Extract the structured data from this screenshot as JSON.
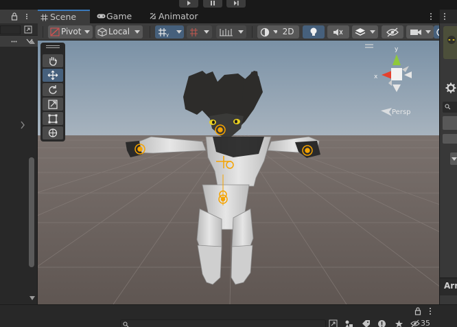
{
  "tabs": [
    {
      "label": "Scene",
      "icon": "grid-icon",
      "active": true
    },
    {
      "label": "Game",
      "icon": "gamepad-icon",
      "active": false
    },
    {
      "label": "Animator",
      "icon": "animator-icon",
      "active": false
    }
  ],
  "toolbar": {
    "pivot_label": "Pivot",
    "local_label": "Local",
    "mode_2d_label": "2D"
  },
  "gizmo": {
    "axis_x_label": "x",
    "axis_y_label": "y",
    "projection_label": "Persp"
  },
  "right_panel": {
    "partial_label": "Arr"
  },
  "bottom_bar": {
    "hidden_count": "35"
  },
  "colors": {
    "accent": "#3a79bb",
    "axis_x": "#e5412e",
    "axis_y": "#8fc93a",
    "bone_gizmo": "#f5a300",
    "sky": "#8d9fb0",
    "ground": "#6e6460"
  }
}
